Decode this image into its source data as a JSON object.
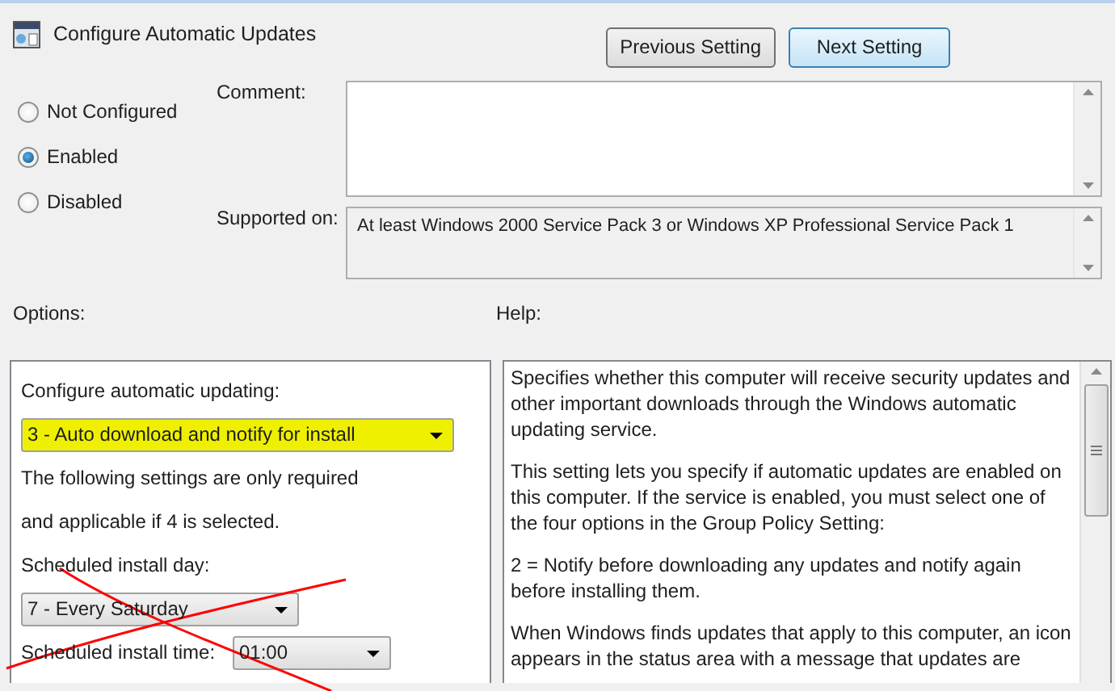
{
  "window": {
    "title": "Configure Automatic Updates"
  },
  "buttons": [
    {
      "label": "Previous Setting",
      "focused": false
    },
    {
      "label": "Next Setting",
      "focused": true
    }
  ],
  "state_options": [
    {
      "label": "Not Configured",
      "selected": false
    },
    {
      "label": "Enabled",
      "selected": true
    },
    {
      "label": "Disabled",
      "selected": false
    }
  ],
  "comment": {
    "label": "Comment:"
  },
  "supported_on": {
    "label": "Supported on:",
    "value": "At least Windows 2000 Service Pack 3 or Windows XP Professional Service Pack 1"
  },
  "options": {
    "label": "Options:",
    "items": [
      {
        "kind": "label",
        "text": "Configure automatic updating:"
      },
      {
        "kind": "dropdown",
        "value": "3 - Auto download and notify for install",
        "highlighted": true,
        "wide": true
      },
      {
        "kind": "text",
        "text": "The following settings are only required"
      },
      {
        "kind": "text",
        "text": "and applicable if 4 is selected."
      },
      {
        "kind": "label",
        "text": "Scheduled install day:"
      },
      {
        "kind": "dropdown",
        "value": "7 - Every Saturday",
        "highlighted": false,
        "wide": false
      },
      {
        "kind": "inline_dropdown",
        "label": "Scheduled install time:",
        "value": "01:00"
      }
    ]
  },
  "help": {
    "label": "Help:",
    "paragraphs": [
      "Specifies whether this computer will receive security updates and other important downloads through the Windows automatic updating service.",
      "This setting lets you specify if automatic updates are enabled on this computer. If the service is enabled, you must select one of the four options in the Group Policy Setting:",
      "2 = Notify before downloading any updates and notify again before installing them.",
      "When Windows finds updates that apply to this computer, an icon appears in the status area with a message that updates are"
    ]
  },
  "annotation": {
    "crossed_out": true
  }
}
